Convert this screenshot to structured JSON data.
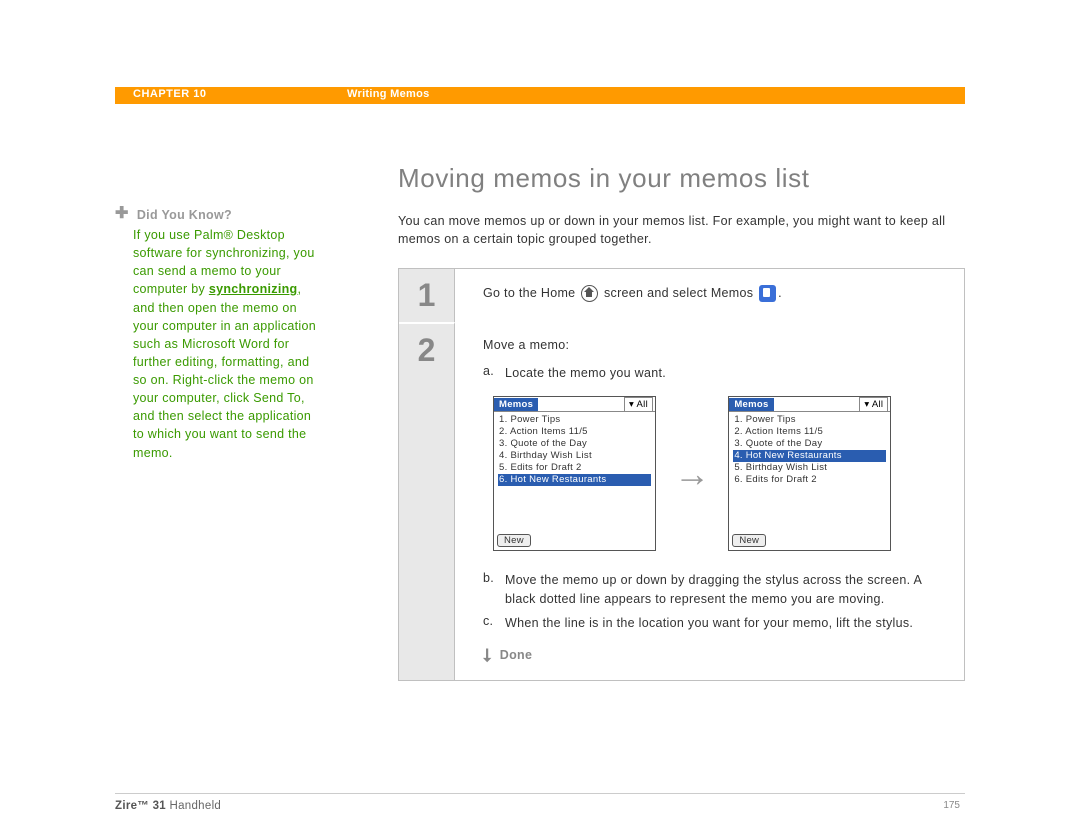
{
  "header": {
    "chapter": "CHAPTER 10",
    "title": "Writing Memos"
  },
  "sidebar": {
    "dyk_label": "Did You Know?",
    "dyk_pre": "If you use Palm® Desktop software for synchronizing, you can send a memo to your computer by ",
    "dyk_link": "synchronizing",
    "dyk_post": ", and then open the memo on your computer in an application such as Microsoft Word for further editing, formatting, and so on. Right-click the memo on your computer, click Send To, and then select the application to which you want to send the memo."
  },
  "main": {
    "heading": "Moving memos in your memos list",
    "intro": "You can move memos up or down in your memos list. For example, you might want to keep all memos on a certain topic grouped together."
  },
  "steps": {
    "s1_num": "1",
    "s1_pre": "Go to the Home ",
    "s1_mid": " screen and select Memos ",
    "s1_post": ".",
    "s2_num": "2",
    "s2_intro": "Move a memo:",
    "s2_a_letter": "a.",
    "s2_a_text": "Locate the memo you want.",
    "s2_b_letter": "b.",
    "s2_b_text": "Move the memo up or down by dragging the stylus across the screen. A black dotted line appears to represent the memo you are moving.",
    "s2_c_letter": "c.",
    "s2_c_text": "When the line is in the location you want for your memo, lift the stylus.",
    "done": "Done"
  },
  "memos_ui": {
    "title": "Memos",
    "all_label": "▾ All",
    "new_label": "New",
    "left": {
      "items": [
        "1. Power Tips",
        "2. Action Items 11/5",
        "3. Quote of the Day",
        "4. Birthday Wish List",
        "5. Edits for Draft 2",
        "6. Hot New Restaurants"
      ],
      "selected_index": 5
    },
    "right": {
      "items": [
        "1. Power Tips",
        "2. Action Items 11/5",
        "3. Quote of the Day",
        "4. Hot New Restaurants",
        "5. Birthday Wish List",
        "6. Edits for Draft 2"
      ],
      "selected_index": 3
    }
  },
  "footer": {
    "product_bold": "Zire™ 31",
    "product_rest": " Handheld",
    "page": "175"
  }
}
